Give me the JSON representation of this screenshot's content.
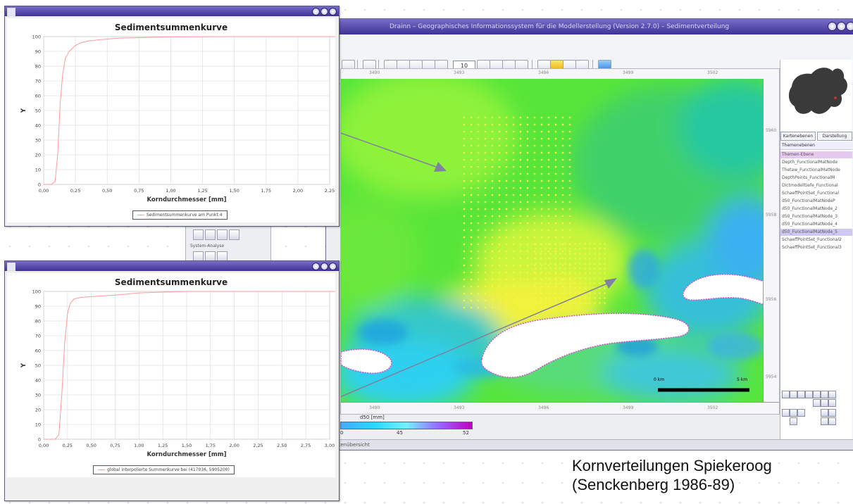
{
  "main_window": {
    "title": "Drainn – Geographisches Informationssystem für die Modellerstellung (Version 2.7.0) – Sedimentverteilung",
    "toolbar": {
      "zoom_value": "10"
    },
    "ruler_top_ticks": [
      "3490",
      "3493",
      "3496",
      "3499",
      "3502"
    ],
    "ruler_bottom_ticks": [
      "3490",
      "3493",
      "3496",
      "3499",
      "3502"
    ],
    "ruler_right_ticks": [
      "5960",
      "5958",
      "5956",
      "5954"
    ],
    "legend": {
      "label": "d50 [mm]",
      "min": "0",
      "mid": "45",
      "max": "52"
    },
    "scale_bar": {
      "left_label": "0 km",
      "right_label": "5 km"
    },
    "status_text": "Kartenübersicht",
    "side_panel": {
      "label": "System-Analyse"
    },
    "right_panel": {
      "tabs": [
        "Kartenebenen",
        "Darstellung"
      ],
      "layers_header": "Themenebenen",
      "layers": [
        "Themen-Ebene",
        "Depth_FunctionalMatNode",
        "Thetaw_FunctionalMatNode",
        "DepthPoints_FunctionalM",
        "Dictmodelltiefe_Functional",
        "SchaeffPointSet_Functional",
        "d50_FunctionalMatNodeP",
        "d50_FunctionalMatNode_2",
        "d50_FunctionalMatNode_3",
        "d50_FunctionalMatNode_4",
        "d50_FunctionalMatNode_5",
        "SchaeffPointSet_Functional2",
        "SchaeffPointSet_Functional3"
      ],
      "selected_layer_index": 0,
      "highlighted_layer_index": 10
    }
  },
  "chart_windows": [
    {
      "title_label": "Sedimentsummenkurve",
      "legend_text": "Sedimentsummenkurve am Punkt 4"
    },
    {
      "title_label": "Sedimentsummenkurve",
      "legend_text": "global interpolierte Summenkurve bei (417036, 5905200)"
    }
  ],
  "chart_data": [
    {
      "type": "line",
      "title": "Sedimentsummenkurve",
      "xlabel": "Korndurchmesser [mm]",
      "ylabel": "Y",
      "xlim": [
        0,
        2.25
      ],
      "ylim": [
        0,
        100
      ],
      "x_ticks": [
        "0,00",
        "0,25",
        "0,50",
        "0,75",
        "1,00",
        "1,25",
        "1,50",
        "1,75",
        "2,00",
        "2,25"
      ],
      "y_ticks": [
        "0",
        "10",
        "20",
        "30",
        "40",
        "50",
        "60",
        "70",
        "80",
        "90",
        "100"
      ],
      "grid": true,
      "legend_position": "bottom",
      "series": [
        {
          "color": "#ff9a9a",
          "x": [
            0,
            0.06,
            0.09,
            0.11,
            0.13,
            0.15,
            0.17,
            0.2,
            0.25,
            0.3,
            0.35,
            0.45,
            0.6,
            1.0,
            1.5,
            2.0,
            2.4
          ],
          "y": [
            0,
            0,
            2,
            20,
            55,
            75,
            85,
            90,
            94,
            96,
            97,
            98,
            99,
            99.8,
            100,
            100,
            100
          ]
        }
      ]
    },
    {
      "type": "line",
      "title": "Sedimentsummenkurve",
      "xlabel": "Korndurchmesser [mm]",
      "ylabel": "Y",
      "xlim": [
        0,
        3.0
      ],
      "ylim": [
        0,
        100
      ],
      "x_ticks": [
        "0,00",
        "0,25",
        "0,50",
        "0,75",
        "1,00",
        "1,25",
        "1,50",
        "1,75",
        "2,00",
        "2,25",
        "2,50",
        "2,75",
        "3,00"
      ],
      "y_ticks": [
        "0",
        "10",
        "20",
        "30",
        "40",
        "50",
        "60",
        "70",
        "80",
        "90",
        "100"
      ],
      "grid": true,
      "legend_position": "bottom",
      "series": [
        {
          "color": "#ff9a9a",
          "x": [
            0,
            0.12,
            0.16,
            0.19,
            0.22,
            0.25,
            0.28,
            0.32,
            0.4,
            0.5,
            0.75,
            1.0,
            1.25,
            1.5,
            2.0,
            2.5,
            3.0,
            3.1
          ],
          "y": [
            0,
            0,
            3,
            30,
            65,
            85,
            92,
            95,
            96,
            96.5,
            97.5,
            99,
            99.5,
            100,
            100,
            100,
            100,
            100
          ]
        }
      ]
    }
  ],
  "caption": {
    "line1": "Kornverteilungen Spiekeroog",
    "line2": "(Senckenberg 1986-89)"
  }
}
